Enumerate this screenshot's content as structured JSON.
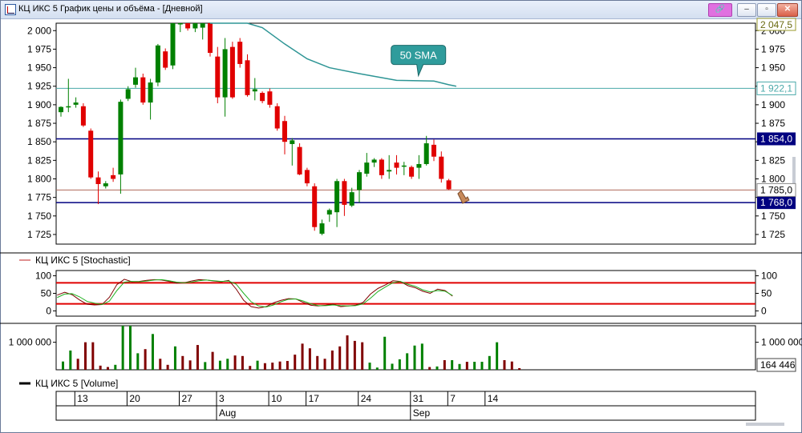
{
  "window": {
    "title": "КЦ ИКС 5 График цены и объёма - [Дневной]",
    "buttons": {
      "minimize": "‒",
      "maximize": "▫",
      "close": "✕",
      "link": "🔗"
    }
  },
  "chart_data": [
    {
      "type": "candlestick",
      "panel": "price",
      "title": "",
      "y_ticks": [
        2000,
        1975,
        1950,
        1925,
        1900,
        1875,
        1850,
        1825,
        1800,
        1775,
        1750,
        1725
      ],
      "y_tick_labels": [
        "2 000",
        "1 975",
        "1 950",
        "1 925",
        "1 900",
        "1 875",
        "1 850",
        "1 825",
        "1 800",
        "1 775",
        "1 750",
        "1 725"
      ],
      "ylim": [
        1712,
        2010
      ],
      "candles": [
        {
          "o": 1890,
          "h": 1898,
          "l": 1884,
          "c": 1897
        },
        {
          "o": 1897,
          "h": 1935,
          "l": 1890,
          "c": 1898
        },
        {
          "o": 1900,
          "h": 1910,
          "l": 1896,
          "c": 1903
        },
        {
          "o": 1898,
          "h": 1902,
          "l": 1870,
          "c": 1872
        },
        {
          "o": 1865,
          "h": 1868,
          "l": 1800,
          "c": 1802
        },
        {
          "o": 1802,
          "h": 1810,
          "l": 1766,
          "c": 1793
        },
        {
          "o": 1790,
          "h": 1797,
          "l": 1787,
          "c": 1794
        },
        {
          "o": 1805,
          "h": 1815,
          "l": 1796,
          "c": 1800
        },
        {
          "o": 1806,
          "h": 1907,
          "l": 1780,
          "c": 1904
        },
        {
          "o": 1908,
          "h": 1925,
          "l": 1905,
          "c": 1921
        },
        {
          "o": 1927,
          "h": 1950,
          "l": 1923,
          "c": 1937
        },
        {
          "o": 1937,
          "h": 1942,
          "l": 1900,
          "c": 1903
        },
        {
          "o": 1903,
          "h": 1935,
          "l": 1880,
          "c": 1930
        },
        {
          "o": 1930,
          "h": 1982,
          "l": 1925,
          "c": 1980
        },
        {
          "o": 1972,
          "h": 1976,
          "l": 1947,
          "c": 1950
        },
        {
          "o": 1953,
          "h": 2010,
          "l": 1948,
          "c": 2010
        },
        {
          "o": 2010,
          "h": 2030,
          "l": 1998,
          "c": 2025
        },
        {
          "o": 2025,
          "h": 2040,
          "l": 2000,
          "c": 2003
        },
        {
          "o": 2003,
          "h": 2030,
          "l": 1998,
          "c": 2025
        },
        {
          "o": 2004,
          "h": 2025,
          "l": 1988,
          "c": 2012
        },
        {
          "o": 2010,
          "h": 2015,
          "l": 1965,
          "c": 1970
        },
        {
          "o": 1965,
          "h": 1978,
          "l": 1902,
          "c": 1910
        },
        {
          "o": 1910,
          "h": 1990,
          "l": 1884,
          "c": 1975
        },
        {
          "o": 1978,
          "h": 1985,
          "l": 1908,
          "c": 1910
        },
        {
          "o": 1985,
          "h": 1990,
          "l": 1950,
          "c": 1955
        },
        {
          "o": 1960,
          "h": 1968,
          "l": 1911,
          "c": 1913
        },
        {
          "o": 1918,
          "h": 1936,
          "l": 1906,
          "c": 1921
        },
        {
          "o": 1916,
          "h": 1918,
          "l": 1902,
          "c": 1905
        },
        {
          "o": 1918,
          "h": 1922,
          "l": 1896,
          "c": 1900
        },
        {
          "o": 1898,
          "h": 1902,
          "l": 1865,
          "c": 1868
        },
        {
          "o": 1878,
          "h": 1885,
          "l": 1833,
          "c": 1850
        },
        {
          "o": 1847,
          "h": 1855,
          "l": 1818,
          "c": 1852
        },
        {
          "o": 1843,
          "h": 1848,
          "l": 1805,
          "c": 1806
        },
        {
          "o": 1812,
          "h": 1815,
          "l": 1790,
          "c": 1794
        },
        {
          "o": 1790,
          "h": 1794,
          "l": 1730,
          "c": 1735
        },
        {
          "o": 1726,
          "h": 1745,
          "l": 1724,
          "c": 1740
        },
        {
          "o": 1752,
          "h": 1760,
          "l": 1742,
          "c": 1758
        },
        {
          "o": 1755,
          "h": 1800,
          "l": 1735,
          "c": 1797
        },
        {
          "o": 1797,
          "h": 1800,
          "l": 1750,
          "c": 1765
        },
        {
          "o": 1764,
          "h": 1788,
          "l": 1762,
          "c": 1782
        },
        {
          "o": 1785,
          "h": 1812,
          "l": 1768,
          "c": 1809
        },
        {
          "o": 1807,
          "h": 1835,
          "l": 1803,
          "c": 1822
        },
        {
          "o": 1822,
          "h": 1828,
          "l": 1816,
          "c": 1826
        },
        {
          "o": 1826,
          "h": 1828,
          "l": 1800,
          "c": 1805
        },
        {
          "o": 1810,
          "h": 1832,
          "l": 1800,
          "c": 1812
        },
        {
          "o": 1822,
          "h": 1832,
          "l": 1806,
          "c": 1815
        },
        {
          "o": 1818,
          "h": 1823,
          "l": 1805,
          "c": 1818
        },
        {
          "o": 1816,
          "h": 1818,
          "l": 1800,
          "c": 1803
        },
        {
          "o": 1815,
          "h": 1832,
          "l": 1800,
          "c": 1820
        },
        {
          "o": 1820,
          "h": 1858,
          "l": 1818,
          "c": 1848
        },
        {
          "o": 1846,
          "h": 1853,
          "l": 1824,
          "c": 1830
        },
        {
          "o": 1830,
          "h": 1837,
          "l": 1795,
          "c": 1800
        },
        {
          "o": 1798,
          "h": 1800,
          "l": 1785,
          "c": 1786
        }
      ],
      "sma": {
        "label": "50 SMA",
        "points": [
          [
            20,
            2040
          ],
          [
            25,
            2020
          ],
          [
            27,
            2004
          ],
          [
            30,
            1982
          ],
          [
            33,
            1962
          ],
          [
            36,
            1950
          ],
          [
            40,
            1942
          ],
          [
            45,
            1933
          ],
          [
            50,
            1932
          ],
          [
            52,
            1927
          ],
          [
            53,
            1925
          ]
        ]
      },
      "horizontal_lines": [
        {
          "value": 1854.0,
          "label": "1 854,0",
          "color": "#000080",
          "style": "label-box"
        },
        {
          "value": 1768.0,
          "label": "1 768,0",
          "color": "#000080",
          "style": "label-box"
        },
        {
          "value": 1922.1,
          "label": "1 922,1",
          "color": "#4aa9a9",
          "style": "label-outline"
        },
        {
          "value": 1785.0,
          "label": "1 785,0",
          "color": "#b0685a",
          "style": "label-plain"
        }
      ],
      "current_value_label": "2 047,5",
      "colors": {
        "up": "#008000",
        "down": "#e00000",
        "sma": "#2e9595"
      }
    },
    {
      "type": "line",
      "panel": "stochastic",
      "legend": "КЦ ИКС 5 [Stochastic]",
      "y_ticks": [
        100,
        50,
        0
      ],
      "y_tick_labels": [
        "100",
        "50",
        "0"
      ],
      "ylim": [
        -15,
        115
      ],
      "levels": [
        80,
        20
      ],
      "series": [
        {
          "color": "#800000",
          "values": [
            30,
            45,
            53,
            46,
            31,
            19,
            17,
            18,
            39,
            75,
            90,
            83,
            84,
            87,
            89,
            88,
            84,
            79,
            80,
            85,
            89,
            88,
            85,
            83,
            87,
            62,
            30,
            12,
            8,
            12,
            23,
            30,
            35,
            34,
            24,
            16,
            14,
            16,
            19,
            12,
            14,
            16,
            24,
            48,
            64,
            74,
            86,
            84,
            72,
            66,
            56,
            50,
            62,
            58,
            42
          ]
        },
        {
          "color": "#20b020",
          "values": [
            40,
            38,
            48,
            49,
            40,
            27,
            22,
            18,
            28,
            58,
            82,
            84,
            83,
            85,
            88,
            89,
            86,
            82,
            80,
            82,
            86,
            88,
            86,
            84,
            85,
            76,
            50,
            26,
            14,
            11,
            17,
            26,
            33,
            34,
            28,
            20,
            15,
            15,
            17,
            15,
            14,
            15,
            20,
            36,
            55,
            68,
            80,
            84,
            76,
            70,
            60,
            54,
            58,
            56,
            44
          ]
        }
      ]
    },
    {
      "type": "bar",
      "panel": "volume",
      "legend": "КЦ ИКС 5 [Volume]",
      "y_ticks": [
        1000000
      ],
      "y_tick_labels": [
        "1 000 000"
      ],
      "ylim": [
        0,
        1600000
      ],
      "current_value_label": "164 446",
      "bars": [
        {
          "v": 300000,
          "d": "up"
        },
        {
          "v": 700000,
          "d": "up"
        },
        {
          "v": 400000,
          "d": "down"
        },
        {
          "v": 1000000,
          "d": "down"
        },
        {
          "v": 1000000,
          "d": "down"
        },
        {
          "v": 150000,
          "d": "down"
        },
        {
          "v": 100000,
          "d": "down"
        },
        {
          "v": 180000,
          "d": "up"
        },
        {
          "v": 1600000,
          "d": "up"
        },
        {
          "v": 1600000,
          "d": "up"
        },
        {
          "v": 600000,
          "d": "up"
        },
        {
          "v": 750000,
          "d": "down"
        },
        {
          "v": 1300000,
          "d": "up"
        },
        {
          "v": 400000,
          "d": "down"
        },
        {
          "v": 180000,
          "d": "down"
        },
        {
          "v": 850000,
          "d": "up"
        },
        {
          "v": 500000,
          "d": "down"
        },
        {
          "v": 340000,
          "d": "down"
        },
        {
          "v": 900000,
          "d": "down"
        },
        {
          "v": 280000,
          "d": "up"
        },
        {
          "v": 650000,
          "d": "down"
        },
        {
          "v": 330000,
          "d": "up"
        },
        {
          "v": 400000,
          "d": "up"
        },
        {
          "v": 520000,
          "d": "down"
        },
        {
          "v": 500000,
          "d": "down"
        },
        {
          "v": 140000,
          "d": "down"
        },
        {
          "v": 330000,
          "d": "up"
        },
        {
          "v": 240000,
          "d": "down"
        },
        {
          "v": 260000,
          "d": "down"
        },
        {
          "v": 300000,
          "d": "down"
        },
        {
          "v": 320000,
          "d": "down"
        },
        {
          "v": 550000,
          "d": "down"
        },
        {
          "v": 950000,
          "d": "down"
        },
        {
          "v": 780000,
          "d": "down"
        },
        {
          "v": 500000,
          "d": "down"
        },
        {
          "v": 400000,
          "d": "down"
        },
        {
          "v": 700000,
          "d": "down"
        },
        {
          "v": 850000,
          "d": "down"
        },
        {
          "v": 1250000,
          "d": "down"
        },
        {
          "v": 1050000,
          "d": "down"
        },
        {
          "v": 1000000,
          "d": "down"
        },
        {
          "v": 260000,
          "d": "up"
        },
        {
          "v": 80000,
          "d": "up"
        },
        {
          "v": 1200000,
          "d": "up"
        },
        {
          "v": 220000,
          "d": "up"
        },
        {
          "v": 380000,
          "d": "up"
        },
        {
          "v": 600000,
          "d": "up"
        },
        {
          "v": 880000,
          "d": "up"
        },
        {
          "v": 950000,
          "d": "up"
        },
        {
          "v": 100000,
          "d": "down"
        },
        {
          "v": 120000,
          "d": "up"
        },
        {
          "v": 350000,
          "d": "down"
        },
        {
          "v": 350000,
          "d": "up"
        },
        {
          "v": 210000,
          "d": "up"
        },
        {
          "v": 290000,
          "d": "down"
        },
        {
          "v": 290000,
          "d": "up"
        },
        {
          "v": 290000,
          "d": "up"
        },
        {
          "v": 500000,
          "d": "up"
        },
        {
          "v": 1000000,
          "d": "up"
        },
        {
          "v": 350000,
          "d": "down"
        },
        {
          "v": 300000,
          "d": "down"
        },
        {
          "v": 60000,
          "d": "down"
        }
      ],
      "colors": {
        "up": "#008000",
        "down": "#800000"
      }
    }
  ],
  "time_axis": {
    "days": [
      {
        "label": "13",
        "index": 1
      },
      {
        "label": "20",
        "index": 8
      },
      {
        "label": "27",
        "index": 15
      },
      {
        "label": "3",
        "index": 20
      },
      {
        "label": "10",
        "index": 27
      },
      {
        "label": "17",
        "index": 32
      },
      {
        "label": "24",
        "index": 39
      },
      {
        "label": "31",
        "index": 46
      },
      {
        "label": "7",
        "index": 51
      },
      {
        "label": "14",
        "index": 56
      }
    ],
    "months": [
      {
        "label": "Aug",
        "index": 20
      },
      {
        "label": "Sep",
        "index": 46
      }
    ]
  }
}
